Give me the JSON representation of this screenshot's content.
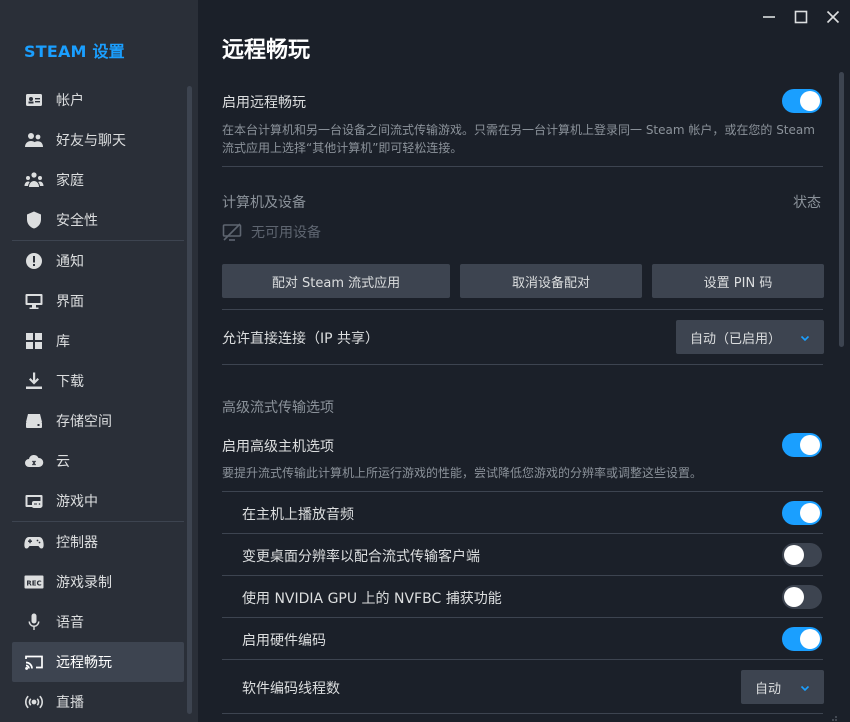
{
  "sidebar": {
    "title": "STEAM 设置",
    "items": [
      {
        "label": "帐户",
        "icon": "account-icon"
      },
      {
        "label": "好友与聊天",
        "icon": "friends-icon"
      },
      {
        "label": "家庭",
        "icon": "family-icon"
      },
      {
        "label": "安全性",
        "icon": "shield-icon"
      },
      {
        "label": "通知",
        "icon": "notification-icon"
      },
      {
        "label": "界面",
        "icon": "monitor-icon"
      },
      {
        "label": "库",
        "icon": "grid-icon"
      },
      {
        "label": "下载",
        "icon": "download-icon"
      },
      {
        "label": "存储空间",
        "icon": "storage-icon"
      },
      {
        "label": "云",
        "icon": "cloud-icon"
      },
      {
        "label": "游戏中",
        "icon": "ingame-icon"
      },
      {
        "label": "控制器",
        "icon": "controller-icon"
      },
      {
        "label": "游戏录制",
        "icon": "rec-icon"
      },
      {
        "label": "语音",
        "icon": "microphone-icon"
      },
      {
        "label": "远程畅玩",
        "icon": "cast-icon"
      },
      {
        "label": "直播",
        "icon": "broadcast-icon"
      }
    ],
    "active_index": 14,
    "rec_badge": "REC"
  },
  "page": {
    "title": "远程畅玩",
    "enable_remote_play": {
      "label": "启用远程畅玩",
      "on": true,
      "description": "在本台计算机和另一台设备之间流式传输游戏。只需在另一台计算机上登录同一 Steam 帐户，或在您的 Steam 流式应用上选择“其他计算机”即可轻松连接。"
    },
    "devices": {
      "header": "计算机及设备",
      "status_header": "状态",
      "empty_text": "无可用设备"
    },
    "buttons": {
      "pair_app": "配对 Steam 流式应用",
      "unpair": "取消设备配对",
      "set_pin": "设置 PIN 码"
    },
    "direct_connect": {
      "label": "允许直接连接（IP 共享）",
      "value": "自动（已启用）"
    },
    "advanced_header": "高级流式传输选项",
    "advanced_host": {
      "label": "启用高级主机选项",
      "on": true,
      "description": "要提升流式传输此计算机上所运行游戏的性能，尝试降低您游戏的分辨率或调整这些设置。"
    },
    "sub_options": [
      {
        "label": "在主机上播放音频",
        "on": true
      },
      {
        "label": "变更桌面分辨率以配合流式传输客户端",
        "on": false
      },
      {
        "label": "使用 NVIDIA GPU 上的 NVFBC 捕获功能",
        "on": false
      },
      {
        "label": "启用硬件编码",
        "on": true
      }
    ],
    "encoder_threads": {
      "label": "软件编码线程数",
      "value": "自动"
    }
  },
  "colors": {
    "accent": "#1a9fff",
    "sidebar_bg": "#2a2f38",
    "main_bg": "#1b2029",
    "control_bg": "#3d4450"
  }
}
